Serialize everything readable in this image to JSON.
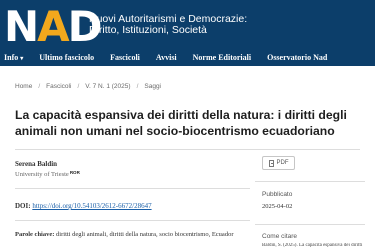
{
  "header": {
    "logo": {
      "n": "N",
      "a": "A",
      "d": "D"
    },
    "site_title_line1": "Nuovi Autoritarismi e Democrazie:",
    "site_title_line2": "Diritto, Istituzioni, Società"
  },
  "nav": {
    "items": [
      {
        "label": "Info",
        "caret": "▾"
      },
      {
        "label": "Ultimo fascicolo"
      },
      {
        "label": "Fascicoli"
      },
      {
        "label": "Avvisi"
      },
      {
        "label": "Norme Editoriali"
      },
      {
        "label": "Osservatorio Nad"
      }
    ]
  },
  "breadcrumb": {
    "items": [
      "Home",
      "Fascicoli",
      "V. 7 N. 1 (2025)",
      "Saggi"
    ],
    "separator": "/"
  },
  "article": {
    "title": "La capacità espansiva dei diritti della natura: i diritti degli animali non umani nel socio-biocentrismo ecuadoriano",
    "author_name": "Serena Baldin",
    "author_affiliation": "University of Trieste",
    "ror_label": "ROR",
    "doi_label": "DOI:",
    "doi_value": "https://doi.org/10.54103/2612-6672/28647",
    "keywords_label": "Parole chiave:",
    "keywords_value": "diritti degli animali, diritti della natura, socio biocentrismo, Ecuador"
  },
  "sidebar": {
    "pdf_label": "PDF",
    "published_label": "Pubblicato",
    "published_date": "2025-04-02",
    "cite_label": "Come citare",
    "cite_text": "Baldin, S. (2025). La capacità espansiva dei diritti"
  },
  "colors": {
    "header_bg": "#0c3e6a",
    "logo_accent": "#f2a81d",
    "link": "#1a5fa8"
  }
}
